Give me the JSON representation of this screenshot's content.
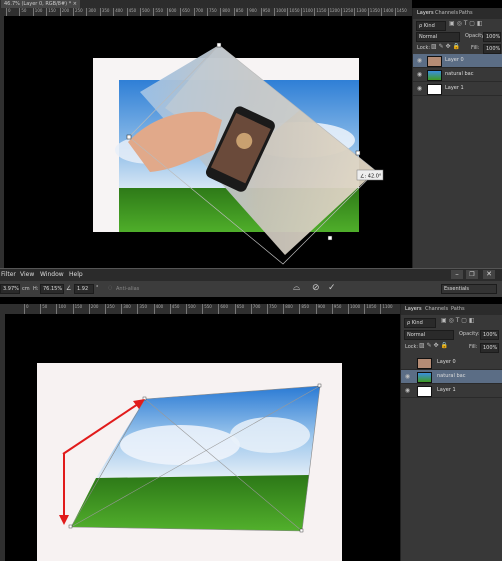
{
  "top": {
    "doc_tab": "46.7% (Layer 0, RGB/8#) * ×",
    "ruler_ticks": [
      "0",
      "50",
      "100",
      "150",
      "200",
      "250",
      "300",
      "350",
      "400",
      "450",
      "500",
      "550",
      "600",
      "650",
      "700",
      "750",
      "800",
      "850",
      "900",
      "950",
      "1000",
      "1050",
      "1100",
      "1150",
      "1200",
      "1250",
      "1300",
      "1350",
      "1400",
      "1450",
      "1500"
    ],
    "angle_label": "∠: 42.0°",
    "panel": {
      "tabs": [
        "Layers",
        "Channels",
        "Paths"
      ],
      "kind": "ρ Kind",
      "blend": "Normal",
      "opacity_label": "Opacity:",
      "opacity": "100%",
      "lock_label": "Lock:",
      "fill_label": "Fill:",
      "fill": "100%",
      "layers": [
        {
          "name": "Layer 0"
        },
        {
          "name": "natural bac"
        },
        {
          "name": "Layer 1"
        }
      ]
    }
  },
  "middle": {
    "menus": [
      "Filter",
      "View",
      "Window",
      "Help"
    ],
    "opts": {
      "x_val": "3.97%",
      "cm": "cm",
      "h_label": "H:",
      "h_val": "76.15%",
      "angle_val": "1.92",
      "deg": "°",
      "antialias": "Anti-alias",
      "workspace": "Essentials"
    }
  },
  "bottom": {
    "ruler_ticks": [
      "0",
      "50",
      "100",
      "150",
      "200",
      "250",
      "300",
      "350",
      "400",
      "450",
      "500",
      "550",
      "600",
      "650",
      "700",
      "750",
      "800",
      "850",
      "900",
      "950",
      "1000",
      "1050",
      "1100",
      "1150",
      "1200"
    ],
    "panel": {
      "tabs": [
        "Layers",
        "Channels",
        "Paths"
      ],
      "kind": "ρ Kind",
      "blend": "Normal",
      "opacity_label": "Opacity:",
      "opacity": "100%",
      "lock_label": "Lock:",
      "fill_label": "Fill:",
      "fill": "100%",
      "layers": [
        {
          "name": "Layer 0"
        },
        {
          "name": "natural bac"
        },
        {
          "name": "Layer 1"
        }
      ]
    }
  },
  "colors": {
    "arrow": "#e11b1b",
    "sky": "#3a8fe0",
    "grass": "#3f9a22",
    "panel": "#383838"
  }
}
